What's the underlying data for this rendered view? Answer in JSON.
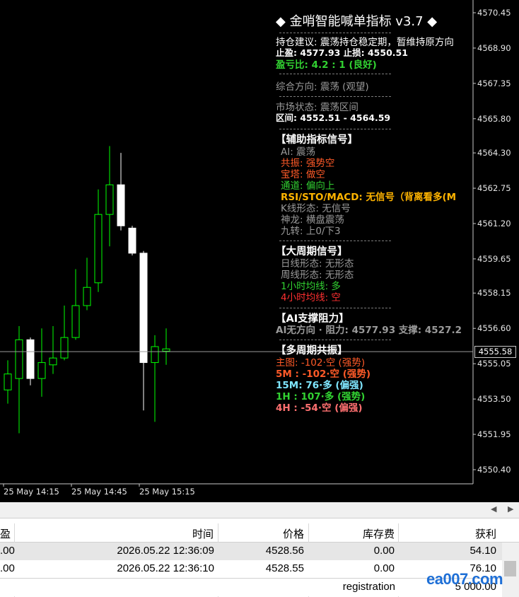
{
  "colors": {
    "bull_candle": "#00ff00",
    "bear_candle": "#ffffff",
    "grid": "#7a7a7a",
    "orange": "#ff5a28",
    "green": "#32d232",
    "yellow": "#ffb400",
    "gray": "#9a9a9a",
    "red": "#ff3030",
    "cyan": "#7fe6ff",
    "salmon": "#ff7070"
  },
  "chart_data": {
    "type": "candlestick",
    "y_ticks": [
      "4570.45",
      "4568.90",
      "4567.35",
      "4565.80",
      "4564.30",
      "4562.75",
      "4561.20",
      "4559.65",
      "4558.15",
      "4556.60",
      "4555.05",
      "4553.50",
      "4551.95",
      "4550.40"
    ],
    "x_ticks": [
      "25 May 14:15",
      "25 May 14:45",
      "25 May 15:15"
    ],
    "current_price": "4555.58",
    "candles": [
      {
        "o": 4553.9,
        "c": 4554.6,
        "h": 4555.2,
        "l": 4553.3
      },
      {
        "o": 4554.4,
        "c": 4556.1,
        "h": 4556.7,
        "l": 4552.0
      },
      {
        "o": 4556.1,
        "c": 4554.4,
        "h": 4556.2,
        "l": 4554.1
      },
      {
        "o": 4554.4,
        "c": 4555.1,
        "h": 4556.6,
        "l": 4553.6
      },
      {
        "o": 4555.0,
        "c": 4555.3,
        "h": 4556.7,
        "l": 4554.6
      },
      {
        "o": 4555.3,
        "c": 4556.2,
        "h": 4557.6,
        "l": 4555.2
      },
      {
        "o": 4556.2,
        "c": 4557.6,
        "h": 4559.2,
        "l": 4556.1
      },
      {
        "o": 4557.6,
        "c": 4558.4,
        "h": 4559.7,
        "l": 4557.4
      },
      {
        "o": 4558.6,
        "c": 4561.6,
        "h": 4562.7,
        "l": 4558.2
      },
      {
        "o": 4561.6,
        "c": 4562.9,
        "h": 4564.6,
        "l": 4560.2
      },
      {
        "o": 4562.9,
        "c": 4561.1,
        "h": 4564.3,
        "l": 4560.9
      },
      {
        "o": 4561.0,
        "c": 4559.9,
        "h": 4561.1,
        "l": 4559.8
      },
      {
        "o": 4559.9,
        "c": 4555.1,
        "h": 4560.0,
        "l": 4553.0
      },
      {
        "o": 4555.1,
        "c": 4555.8,
        "h": 4556.3,
        "l": 4552.5
      },
      {
        "o": 4555.6,
        "c": 4555.7,
        "h": 4556.6,
        "l": 4555.0
      }
    ]
  },
  "panel": {
    "title": "◆ 金哨智能喊单指标 v3.7 ◆",
    "advice": "持仓建议: 震荡持仓稳定期，暂维持原方向",
    "tp_sl": " 止盈: 4577.93  止损: 4550.51",
    "rr": "盈亏比: 4.2 : 1 (良好)",
    "overall": "综合方向: 震荡 (观望)",
    "market_state": "市场状态: 震荡区间",
    "range": "  区间: 4552.51 - 4564.59",
    "aux_header": "【辅助指标信号】",
    "aux": [
      "AI: 震荡",
      "共振: 强势空",
      "宝塔: 做空",
      "通道: 偏向上",
      "RSI/STO/MACD: 无信号（背离看多(M",
      "K线形态: 无信号",
      "神龙: 横盘震荡",
      "九转: 上0/下3"
    ],
    "big_header": "【大周期信号】",
    "big": [
      "日线形态: 无形态",
      "周线形态: 无形态",
      "1小时均线: 多",
      "4小时均线: 空"
    ],
    "ai_header": "【AI支撑阻力】",
    "ai_sr": "AI无方向 · 阻力: 4577.93   支撑: 4527.2",
    "multi_header": "【多周期共振】",
    "multi": [
      "主图: -102·空 (强势)",
      "5M : -102·空 (强势)",
      "15M: 76·多 (偏强)",
      "1H : 107·多 (强势)",
      "4H : -54·空 (偏强)"
    ]
  },
  "terminal": {
    "columns": [
      "盈",
      "时间",
      "价格",
      "库存费",
      "获利"
    ],
    "rows": [
      {
        "c0": ".00",
        "time": "2026.05.22 12:36:09",
        "price": "4528.56",
        "swap": "0.00",
        "profit": "54.10"
      },
      {
        "c0": ".00",
        "time": "2026.05.22 12:36:10",
        "price": "4528.55",
        "swap": "0.00",
        "profit": "76.10"
      }
    ],
    "footer_label": "registration",
    "footer_value": "5 000.00",
    "watermark": "ea007.com"
  }
}
